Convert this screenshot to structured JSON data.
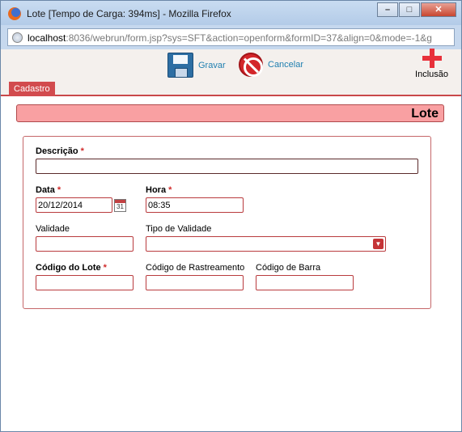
{
  "window": {
    "title": "Lote [Tempo de Carga: 394ms] - Mozilla Firefox",
    "url_host": "localhost",
    "url_rest": ":8036/webrun/form.jsp?sys=SFT&action=openform&formID=37&align=0&mode=-1&g"
  },
  "toolbar": {
    "save_label": "Gravar",
    "cancel_label": "Cancelar",
    "add_label": "Inclusão"
  },
  "tabs": [
    {
      "label": "Cadastro",
      "active": true
    }
  ],
  "header": {
    "title": "Lote"
  },
  "form": {
    "descricao": {
      "label": "Descrição",
      "required_mark": "*",
      "value": ""
    },
    "data": {
      "label": "Data",
      "required_mark": "*",
      "value": "20/12/2014"
    },
    "hora": {
      "label": "Hora",
      "required_mark": "*",
      "value": "08:35"
    },
    "validade": {
      "label": "Validade",
      "value": ""
    },
    "tipo_validade": {
      "label": "Tipo de Validade",
      "value": ""
    },
    "codigo_lote": {
      "label": "Código do Lote",
      "required_mark": "*",
      "value": ""
    },
    "codigo_rastreamento": {
      "label": "Código de Rastreamento",
      "value": ""
    },
    "codigo_barra": {
      "label": "Código de Barra",
      "value": ""
    }
  },
  "colors": {
    "accent": "#d24b4e",
    "header_bg": "#f9a0a2",
    "link": "#1f7fb0"
  }
}
